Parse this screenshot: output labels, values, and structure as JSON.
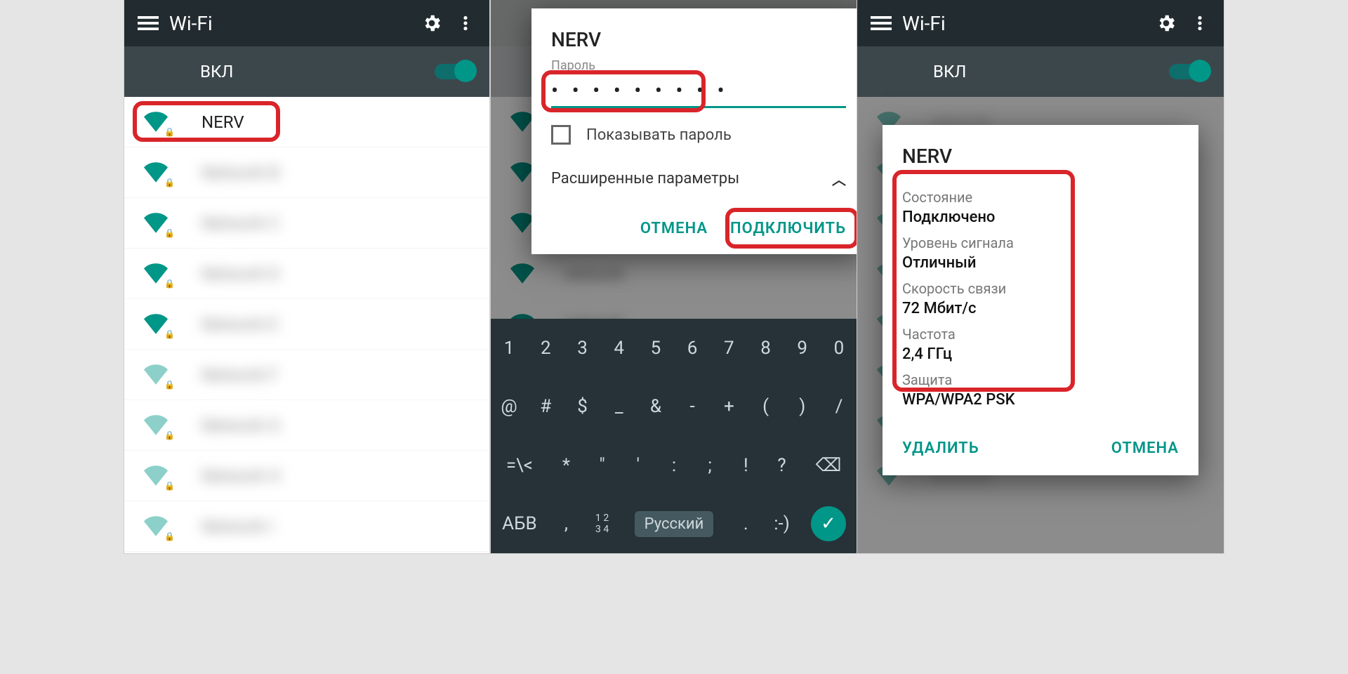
{
  "screen1": {
    "title": "Wi-Fi",
    "switch_label": "ВКЛ",
    "networks": [
      {
        "name": "NERV",
        "blur": false,
        "highlight": true
      },
      {
        "name": "Network B",
        "blur": true
      },
      {
        "name": "Network C",
        "blur": true
      },
      {
        "name": "Network D",
        "blur": true
      },
      {
        "name": "Network E",
        "blur": true
      },
      {
        "name": "Network F",
        "blur": true
      },
      {
        "name": "Network G",
        "blur": true
      },
      {
        "name": "Network H",
        "blur": true
      },
      {
        "name": "Network I",
        "blur": true
      }
    ]
  },
  "screen2": {
    "dialog": {
      "title": "NERV",
      "password_label": "Пароль",
      "password_masked": "• • • • • • • • •",
      "show_password": "Показывать пароль",
      "advanced": "Расширенные параметры",
      "cancel": "ОТМЕНА",
      "connect": "ПОДКЛЮЧИТЬ"
    },
    "keyboard": {
      "row1": [
        "1",
        "2",
        "3",
        "4",
        "5",
        "6",
        "7",
        "8",
        "9",
        "0"
      ],
      "row2": [
        "@",
        "#",
        "$",
        "_",
        "&",
        "-",
        "+",
        "(",
        ")"
      ],
      "row3_left": "=\\<",
      "row3": [
        "*",
        "\"",
        "'",
        ":",
        ";",
        "!",
        "?"
      ],
      "row3_bksp": "⌫",
      "row4_abc": "АБВ",
      "row4_sym": ",",
      "row4_frac": "1 2\n3 4",
      "row4_lang": "Русский",
      "row4_dot": ".",
      "row4_smile": ":-)"
    }
  },
  "screen3": {
    "title": "Wi-Fi",
    "switch_label": "ВКЛ",
    "dialog": {
      "title": "NERV",
      "items": [
        {
          "k": "Состояние",
          "v": "Подключено"
        },
        {
          "k": "Уровень сигнала",
          "v": "Отличный"
        },
        {
          "k": "Скорость связи",
          "v": "72 Мбит/с"
        },
        {
          "k": "Частота",
          "v": "2,4 ГГц"
        },
        {
          "k": "Защита",
          "v": "WPA/WPA2 PSK"
        }
      ],
      "forget": "УДАЛИТЬ",
      "cancel": "ОТМЕНА"
    }
  }
}
